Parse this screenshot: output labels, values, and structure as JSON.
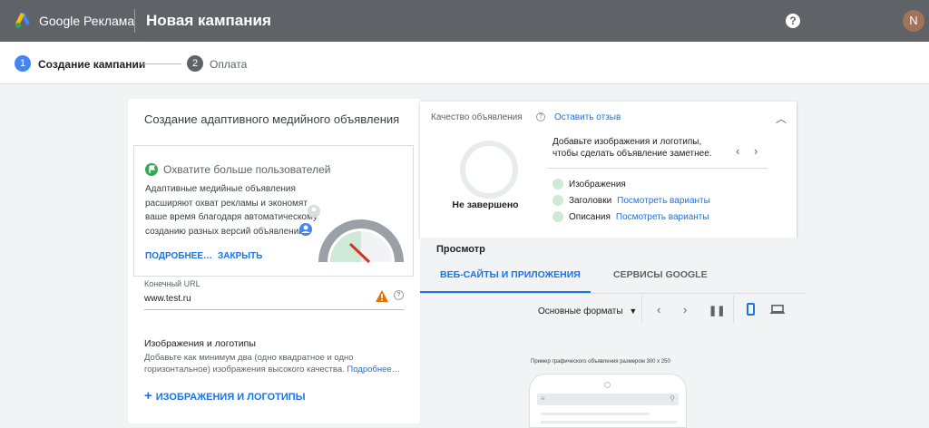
{
  "header": {
    "brand": "Google Реклама",
    "title": "Новая кампания",
    "help_icon": "help-circle-icon",
    "avatar_letter": "N"
  },
  "steps": [
    {
      "num": "1",
      "label": "Создание кампании",
      "active": true
    },
    {
      "num": "2",
      "label": "Оплата",
      "active": false
    }
  ],
  "ad_form": {
    "title": "Создание адаптивного медийного объявления",
    "reach": {
      "title": "Охватите больше пользователей",
      "body": "Адаптивные медийные объявления расширяют охват рекламы и экономят ваше время благодаря автоматическому созданию разных версий объявлений.",
      "more": "Подробнее…",
      "close": "Закрыть"
    },
    "url": {
      "label": "Конечный URL",
      "value": "www.test.ru"
    },
    "images": {
      "title": "Изображения и логотипы",
      "desc": "Добавьте как минимум два (одно квадратное и одно горизонтальное) изображения высокого качества.",
      "more": "Подробнее…",
      "add": "Изображения и логотипы"
    }
  },
  "quality": {
    "title": "Качество объявления",
    "feedback": "Оставить отзыв",
    "status": "Не завершено",
    "tip": "Добавьте изображения и логотипы, чтобы сделать объявление заметнее.",
    "items": [
      {
        "label": "Изображения",
        "link": ""
      },
      {
        "label": "Заголовки",
        "link": "Посмотреть варианты"
      },
      {
        "label": "Описания",
        "link": "Посмотреть варианты"
      }
    ]
  },
  "preview": {
    "title": "Просмотр",
    "tabs": [
      "Веб-сайты и приложения",
      "Сервисы Google"
    ],
    "formats": "Основные форматы",
    "sample_caption": "Пример графического объявления размером 300 x 250"
  },
  "colors": {
    "accent": "#1a73e8",
    "topbar": "#5f6368",
    "success": "#34a853",
    "warning": "#e37400"
  }
}
